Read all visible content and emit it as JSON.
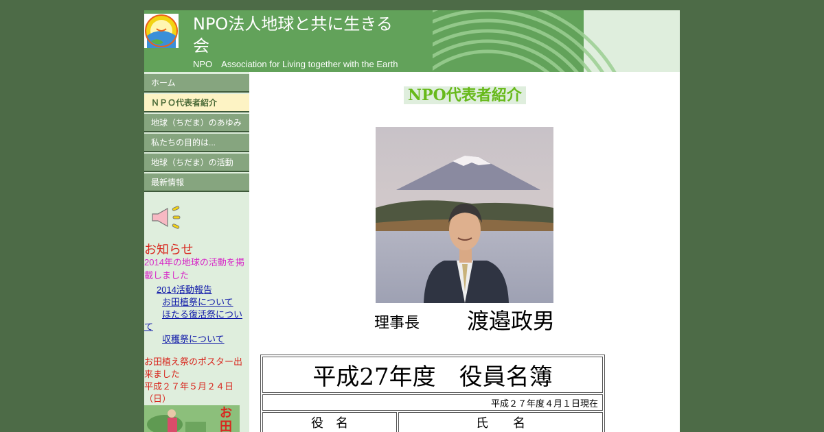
{
  "header": {
    "title": "NPO法人地球と共に生きる会",
    "subtitle": "NPO　Association for Living together with the Earth"
  },
  "nav": {
    "items": [
      {
        "label": "ホーム"
      },
      {
        "label": "ＮＰＯ代表者紹介"
      },
      {
        "label": "地球（ちだま）のあゆみ"
      },
      {
        "label": "私たちの目的は..."
      },
      {
        "label": "地球（ちだま）の活動"
      },
      {
        "label": "最新情報"
      }
    ]
  },
  "news": {
    "title": "お知らせ",
    "intro": "2014年の地球の活動を掲載しました",
    "links": [
      {
        "label": "2014活動報告"
      },
      {
        "label": "お田植祭について"
      },
      {
        "label": "ほたる復活祭について"
      },
      {
        "label": "収穫祭について"
      }
    ],
    "poster_text": "お田植え祭のポスター出来ました",
    "poster_date": "平成２７年５月２４日（日）",
    "poster_image_text": "お田"
  },
  "main": {
    "heading": "NPO代表者紹介",
    "role": "理事長",
    "name": "渡邉政男"
  },
  "roster": {
    "title": "平成27年度　役員名簿",
    "as_of": "平成２７年度４月１日現在",
    "col_role": "役　名",
    "col_name": "氏　　名"
  },
  "icons": {
    "logo": "sun-earth-logo-icon",
    "megaphone": "megaphone-icon"
  },
  "colors": {
    "background": "#4d6b47",
    "header_green": "#62a25a",
    "nav_item": "#86a57f",
    "nav_active": "#fdf3c4",
    "heading_green": "#67b91a",
    "link_blue": "#0b15a8",
    "notice_red": "#d8271e",
    "notice_pink": "#d726c7"
  }
}
